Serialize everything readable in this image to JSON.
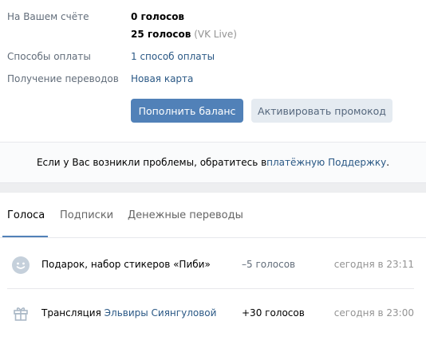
{
  "balance": {
    "account_label": "На Вашем счёте",
    "votes_value": "0 голосов",
    "vklive_value": "25 голосов",
    "vklive_note": "(VK Live)",
    "payment_methods_label": "Способы оплаты",
    "payment_methods_value": "1 способ оплаты",
    "receive_label": "Получение переводов",
    "receive_value": "Новая карта",
    "topup_button": "Пополнить баланс",
    "promo_button": "Активировать промокод"
  },
  "notice": {
    "text_before": "Если у Вас возникли проблемы, обратитесь в ",
    "link": "платёжную Поддержку",
    "text_after": "."
  },
  "tabs": [
    {
      "label": "Голоса",
      "active": true
    },
    {
      "label": "Подписки",
      "active": false
    },
    {
      "label": "Денежные переводы",
      "active": false
    }
  ],
  "transactions": [
    {
      "icon": "smile-icon",
      "description": "Подарок, набор стикеров «Пиби»",
      "amount": "–5 голосов",
      "date": "сегодня в 23:11"
    },
    {
      "icon": "gift-icon",
      "description_prefix": "Трансляция ",
      "description_link": "Эльвиры Сиянгуловой",
      "amount": "+30 голосов",
      "date": "сегодня в 23:00"
    }
  ],
  "colors": {
    "accent": "#5181b8",
    "link": "#2a5885",
    "muted": "#939393",
    "label": "#626d7a"
  }
}
